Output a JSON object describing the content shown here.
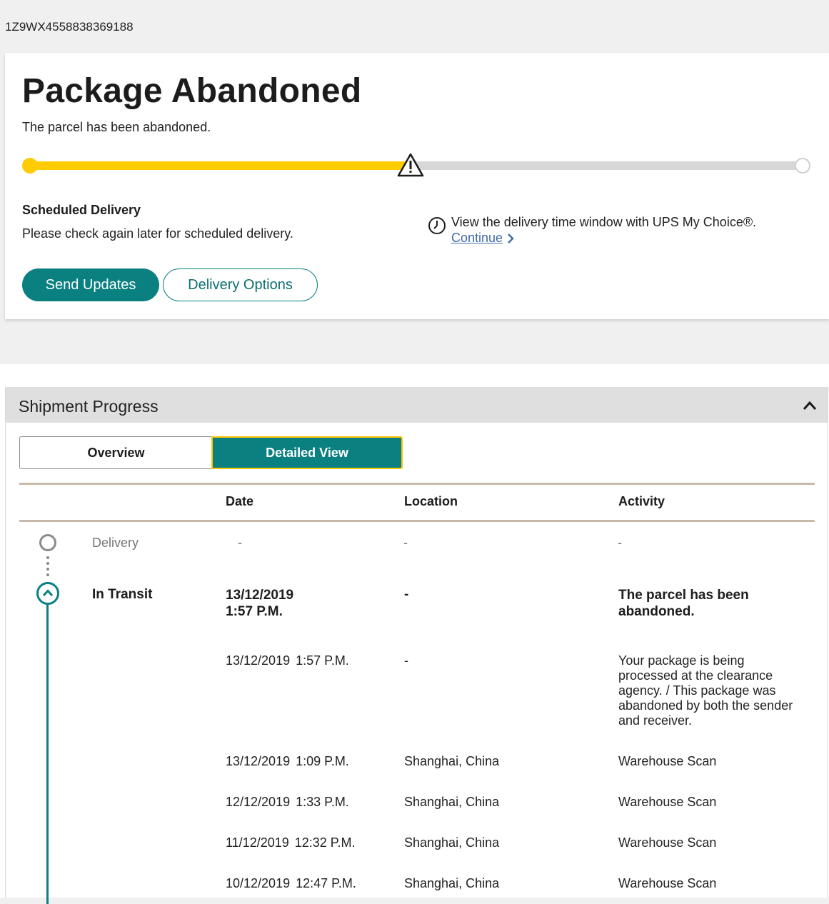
{
  "tracking_number": "1Z9WX4558838369188",
  "status": {
    "title": "Package Abandoned",
    "subtitle": "The parcel has been abandoned.",
    "progress_fraction": 0.49
  },
  "scheduled": {
    "label": "Scheduled Delivery",
    "text": "Please check again later for scheduled delivery."
  },
  "my_choice": {
    "text": "View the delivery time window with UPS My Choice®.",
    "link": "Continue"
  },
  "buttons": {
    "send_updates": "Send Updates",
    "delivery_options": "Delivery Options"
  },
  "shipment_progress": {
    "title": "Shipment Progress",
    "tabs": {
      "overview": "Overview",
      "detailed": "Detailed View"
    },
    "columns": {
      "date": "Date",
      "location": "Location",
      "activity": "Activity"
    },
    "milestones": {
      "delivery": {
        "label": "Delivery",
        "date": "-",
        "location": "-",
        "activity": "-"
      },
      "in_transit": {
        "label": "In Transit",
        "date": "13/12/2019",
        "time": "1:57 P.M.",
        "location": "-",
        "activity": "The parcel has been abandoned."
      }
    },
    "events": [
      {
        "date": "13/12/2019",
        "time": "1:57 P.M.",
        "location": "-",
        "activity": "Your package is being processed at the clearance agency. / This package was abandoned by both the sender and receiver."
      },
      {
        "date": "13/12/2019",
        "time": "1:09 P.M.",
        "location": "Shanghai, China",
        "activity": "Warehouse Scan"
      },
      {
        "date": "12/12/2019",
        "time": "1:33 P.M.",
        "location": "Shanghai, China",
        "activity": "Warehouse Scan"
      },
      {
        "date": "11/12/2019",
        "time": "12:32 P.M.",
        "location": "Shanghai, China",
        "activity": "Warehouse Scan"
      },
      {
        "date": "10/12/2019",
        "time": "12:47 P.M.",
        "location": "Shanghai, China",
        "activity": "Warehouse Scan"
      }
    ]
  },
  "colors": {
    "ups_teal": "#0a8080",
    "progress_yellow": "#ffcc00",
    "link_blue": "#426da9",
    "focus_gold": "#ffc400"
  },
  "icons": [
    "warning-icon",
    "clock-icon",
    "chevron-right-icon",
    "chevron-up-icon"
  ]
}
